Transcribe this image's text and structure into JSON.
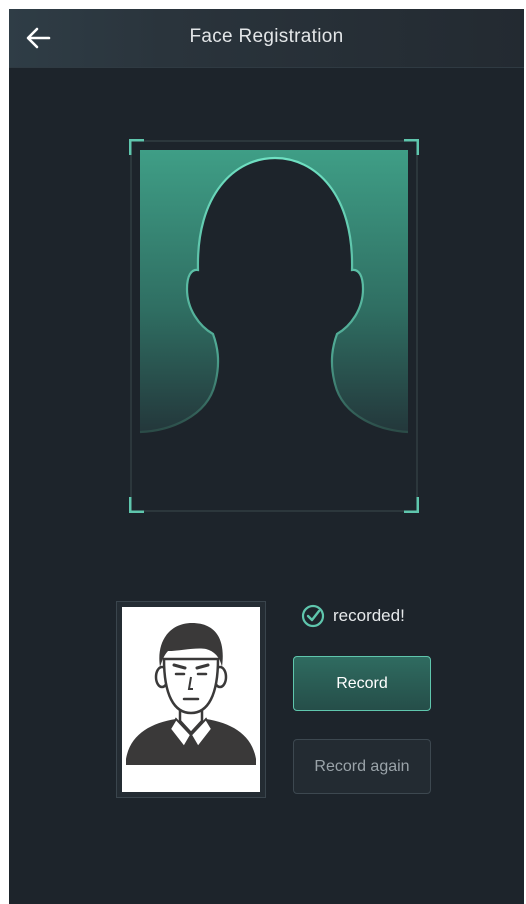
{
  "header": {
    "title": "Face Registration",
    "back_icon": "back-arrow-icon"
  },
  "capture": {
    "frame_icon": "face-outline-frame",
    "accent_color": "#5fc6ad"
  },
  "result": {
    "status_text": "recorded!",
    "status_icon": "check-circle-icon",
    "record_label": "Record",
    "record_again_label": "Record again"
  }
}
